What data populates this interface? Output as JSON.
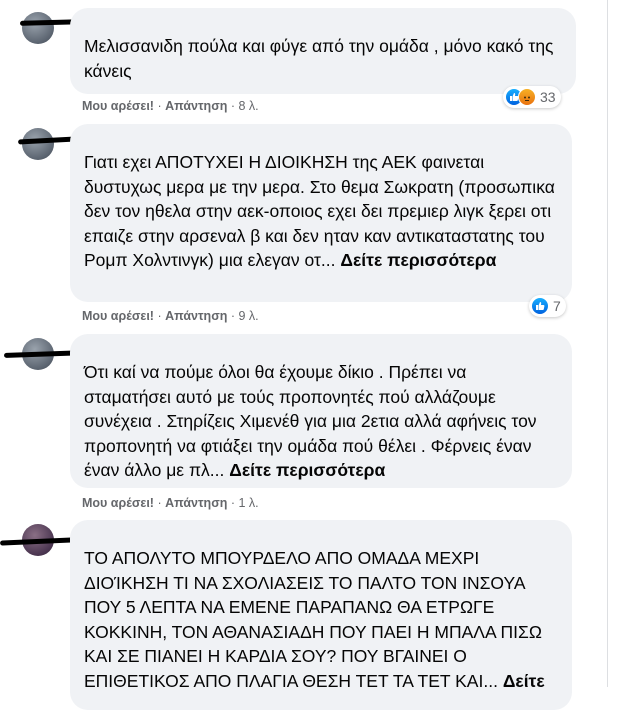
{
  "comments": [
    {
      "author": "",
      "text": "Μελισσανιδη πούλα και φύγε από την ομάδα , μόνο κακό της κάνεις",
      "see_more": "",
      "like": "Μου αρέσει!",
      "reply": "Απάντηση",
      "time": "8 λ.",
      "reaction_count": "33",
      "reaction_icons": [
        "like-icon",
        "angry-icon"
      ]
    },
    {
      "author": "",
      "text": "Γιατι εχει ΑΠΟΤΥΧΕΙ Η ΔΙΟΙΚΗΣΗ της ΑΕΚ φαινεται δυστυχως μερα με την μερα. Στο θεμα Σωκρατη (προσωπικα δεν τον ηθελα στην αεκ-οποιος εχει δει πρεμιερ λιγκ ξερει οτι επαιζε στην αρσεναλ β και δεν ηταν καν αντικαταστατης του Ρομπ Χολντινγκ) μια ελεγαν οτ...",
      "see_more": "Δείτε περισσότερα",
      "like": "Μου αρέσει!",
      "reply": "Απάντηση",
      "time": "9 λ.",
      "reaction_count": "7",
      "reaction_icons": [
        "like-icon"
      ]
    },
    {
      "author": "",
      "text": "Ότι καί να πούμε όλοι θα έχουμε δίκιο . Πρέπει να σταματήσει αυτό με τούς προπονητές πού αλλάζουμε συνέχεια . Στηρίζεις Χιμενέθ για μια 2ετια αλλά αφήνεις τον προπονητή να φτιάξει την ομάδα πού θέλει . Φέρνεις έναν έναν άλλο με πλ...",
      "see_more": "Δείτε περισσότερα",
      "like": "Μου αρέσει!",
      "reply": "Απάντηση",
      "time": "1 λ.",
      "reaction_count": "",
      "reaction_icons": []
    },
    {
      "author": "",
      "text": "ΤΟ ΑΠΟΛΥΤΟ ΜΠΟΥΡΔΕΛΟ ΑΠΟ ΟΜΑΔΑ ΜΕΧΡΙ ΔΙΟΊΚΗΣΗ ΤΙ ΝΑ ΣΧΟΛΙΑΣΕΙΣ ΤΟ ΠΑΛΤΟ ΤΟΝ ΙΝΣΟΥΑ ΠΟΥ 5 ΛΕΠΤΑ ΝΑ ΕΜΕΝΕ ΠΑΡΑΠΑΝΩ ΘΑ ΕΤΡΩΓΕ ΚΟΚΚΙΝΗ, ΤΟΝ ΑΘΑΝΑΣΙΑΔΗ ΠΟΥ ΠΑΕΙ Η ΜΠΑΛΑ ΠΙΣΩ ΚΑΙ ΣΕ ΠΙΑΝΕΙ Η ΚΑΡΔΙΑ ΣΟΥ? ΠΟΥ ΒΓΑΙΝΕΙ Ο ΕΠΙΘΕΤΙΚΟΣ ΑΠΟ ΠΛΑΓΙΑ ΘΕΣΗ ΤΕΤ ΤΑ ΤΕΤ ΚΑΙ...",
      "see_more": "Δείτε",
      "like": "",
      "reply": "",
      "time": "",
      "reaction_count": "",
      "reaction_icons": []
    }
  ],
  "separator": " · "
}
